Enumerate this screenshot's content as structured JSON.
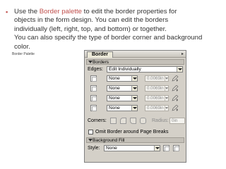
{
  "bullet": {
    "line1_pre": "Use the ",
    "line1_hl": "Border palette",
    "line1_post": " to edit the border properties for",
    "line2": "objects in the form design. You can edit the borders",
    "line3": "individually (left, right, top, and bottom) or together.",
    "line4": "You can also specify the type of border corner and background",
    "line5": "color."
  },
  "caption": "Border Palette",
  "palette": {
    "tab_label": "Border",
    "menu_label": "▸",
    "borders_section": "Borders",
    "edges_label": "Edges:",
    "edges_value": "Edit Individually",
    "edge_rows": [
      {
        "style": "None",
        "width": "0.0069in"
      },
      {
        "style": "None",
        "width": "0.0069in"
      },
      {
        "style": "None",
        "width": "0.0069in"
      },
      {
        "style": "None",
        "width": "0.0069in"
      }
    ],
    "corners_label": "Corners:",
    "radius_label": "Radius:",
    "radius_value": "0in",
    "omit_label": "Omit Border around Page Breaks",
    "fill_section": "Background Fill",
    "style_label": "Style:",
    "style_value": "None"
  },
  "colors": {
    "highlight": "#c0504d",
    "panel_bg": "#d4d0c8",
    "text": "#333333"
  }
}
